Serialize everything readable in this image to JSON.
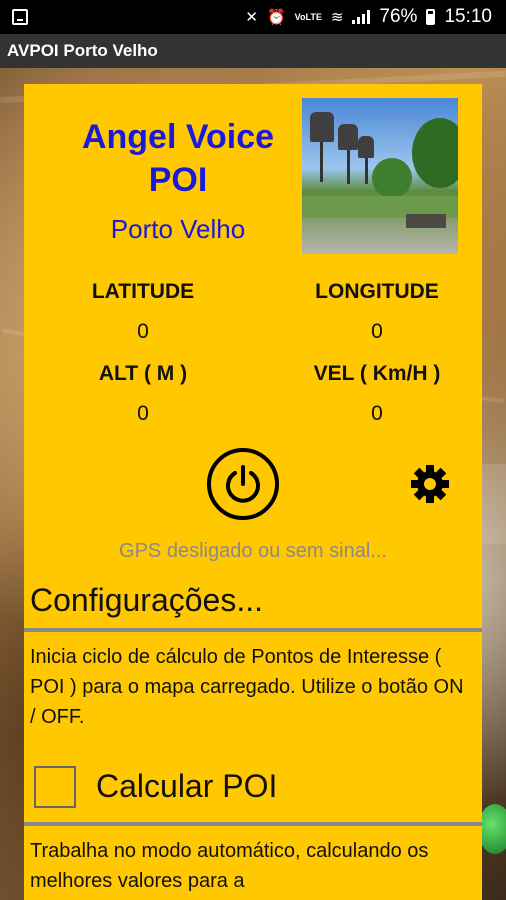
{
  "status_bar": {
    "battery": "76%",
    "time": "15:10",
    "icons": [
      "screenshot-icon",
      "mute-icon",
      "alarm-icon",
      "volte-icon",
      "wifi-icon",
      "signal-icon",
      "battery-icon"
    ]
  },
  "app_bar": {
    "title": "AVPOI Porto Velho"
  },
  "header": {
    "app_name": "Angel Voice POI",
    "city": "Porto Velho",
    "photo": "city-landmark-photo"
  },
  "gps": {
    "latitude_label": "LATITUDE",
    "latitude_value": "0",
    "longitude_label": "LONGITUDE",
    "longitude_value": "0",
    "altitude_label": "ALT ( M )",
    "altitude_value": "0",
    "velocity_label": "VEL ( Km/H )",
    "velocity_value": "0",
    "status_text": "GPS desligado ou sem sinal..."
  },
  "controls": {
    "power_icon": "power-icon",
    "settings_icon": "gear-icon"
  },
  "settings": {
    "title": "Configurações...",
    "description_1": "Inicia ciclo de cálculo de Pontos de Interesse ( POI ) para o mapa carregado. Utilize o botão ON / OFF.",
    "calc_poi_label": "Calcular POI",
    "calc_poi_checked": false,
    "description_2": "Trabalha no modo automático, calculando os melhores valores para a"
  },
  "colors": {
    "panel": "#ffc800",
    "title_blue": "#1a1adb",
    "status_gray": "#8a8a8a"
  }
}
